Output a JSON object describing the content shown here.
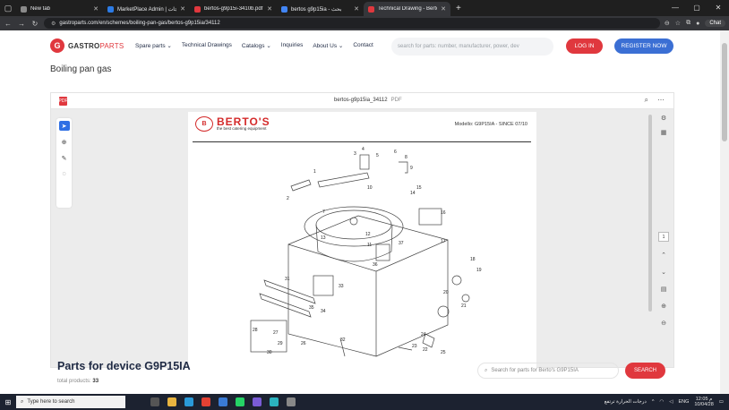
{
  "browser": {
    "tabs": [
      {
        "title": "New tab",
        "color": "#8a8a8a"
      },
      {
        "title": "MarketPlace Admin | منتجات",
        "color": "#2c7be5"
      },
      {
        "title": "bertos-g9p15i-3410b.pdf",
        "color": "#e0383e"
      },
      {
        "title": "bertos g9p15ia - بحث",
        "color": "#4285f4"
      },
      {
        "title": "Technical Drawing - Berto's G9P1...",
        "color": "#e0383e"
      }
    ],
    "url": "gastroparts.com/en/schemes/boiling-pan-gas/bertos-g9p15ia/34112",
    "chat_label": "Chat"
  },
  "header": {
    "logo_text": "GASTRO",
    "logo_suffix": "PARTS",
    "logo_mark": "G",
    "nav": [
      "Spare parts ⌄",
      "Technical Drawings",
      "Catalogs ⌄",
      "Inquiries",
      "About Us ⌄",
      "Contact"
    ],
    "search_placeholder": "search for parts: number, manufacturer, power, dev",
    "login_label": "LOG IN",
    "register_label": "REGISTER NOW"
  },
  "page_title": "Boiling pan gas",
  "viewer": {
    "document_name": "bertos-g9p15ia_34112",
    "document_ext": "PDF",
    "page_number": "1",
    "pdf_badge": "PDF",
    "brand_name": "BERTO'S",
    "brand_tagline": "the best catering equipment",
    "model_text": "Modello: G9P15IA - SINCE 07/10",
    "callouts": [
      "1",
      "2",
      "3",
      "4",
      "5",
      "6",
      "7",
      "8",
      "9",
      "10",
      "11",
      "12",
      "13",
      "14",
      "15",
      "16",
      "17",
      "18",
      "19",
      "20",
      "21",
      "22",
      "23",
      "24",
      "25",
      "26",
      "27",
      "28",
      "29",
      "30",
      "31",
      "32",
      "33",
      "34",
      "35",
      "36",
      "37"
    ]
  },
  "parts": {
    "title": "Parts for device G9P15IA",
    "total_label": "total products:",
    "total_value": "33",
    "search_placeholder": "Search for parts for Berto's G9P15IA",
    "search_button": "SEARCH"
  },
  "taskbar": {
    "search_placeholder": "Type here to search",
    "weather": "درجات الحرارة ترتفع",
    "lang": "ENG",
    "time": "12:05 م",
    "date": "10/04/28"
  }
}
